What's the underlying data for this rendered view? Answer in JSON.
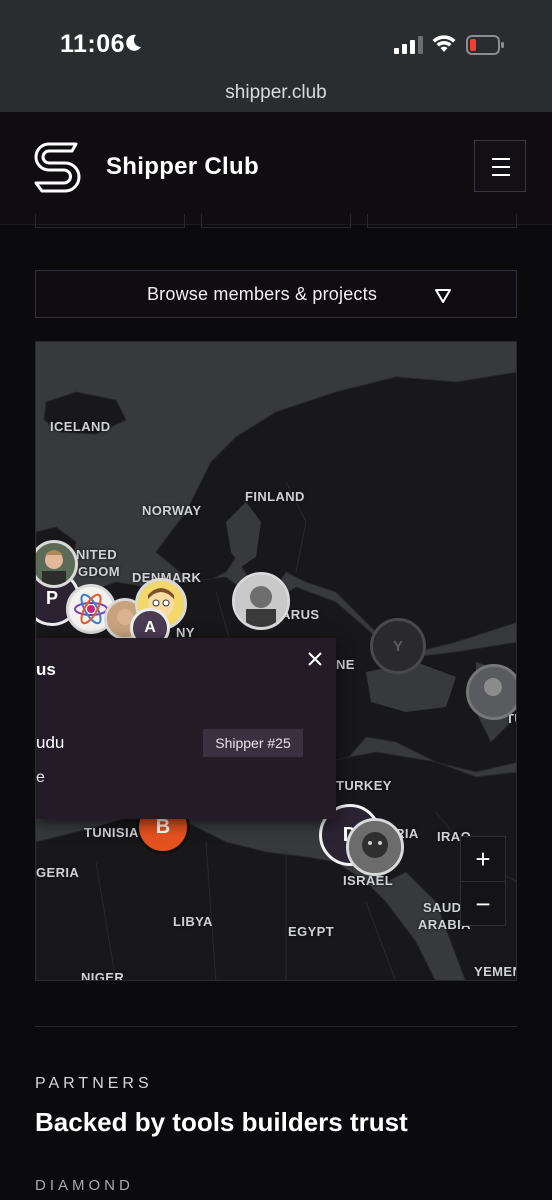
{
  "status_bar": {
    "time": "11:06"
  },
  "browser": {
    "url": "shipper.club"
  },
  "header": {
    "brand": "Shipper Club"
  },
  "browse": {
    "label": "Browse members & projects"
  },
  "map": {
    "labels": {
      "iceland": "ICELAND",
      "finland": "FINLAND",
      "norway": "NORWAY",
      "united": "NITED",
      "kingdom": "GDOM",
      "denmark": "DENMARK",
      "belarus": "ARUS",
      "ny": "NY",
      "ne": "NE",
      "turkey": "TURKEY",
      "tunisia": "TUNISIA",
      "syria": "YRIA",
      "iraq": "IRAQ",
      "algeria": "GERIA",
      "israel": "ISRAEL",
      "saudi1": "SAUDI",
      "saudi2": "ARABIA",
      "libya": "LIBYA",
      "egypt": "EGYPT",
      "niger": "NIGER",
      "yemen": "YEMEN",
      "tu": "TU"
    },
    "clusters": {
      "p": "P",
      "a": "A",
      "y": "Y",
      "b": "B",
      "d": "D"
    },
    "popup": {
      "title": "us",
      "name": "udu",
      "badge": "Shipper #25",
      "extra": "e"
    },
    "zoom": {
      "in": "+",
      "out": "−"
    }
  },
  "partners": {
    "eyebrow": "PARTNERS",
    "heading": "Backed by tools builders trust",
    "tier": "DIAMOND"
  },
  "colors": {
    "background": "#0b0a0c",
    "map_water": "#37393d",
    "map_land": "#171719",
    "accent_orange": "#e4521f",
    "cluster_purple": "#2b2331"
  }
}
